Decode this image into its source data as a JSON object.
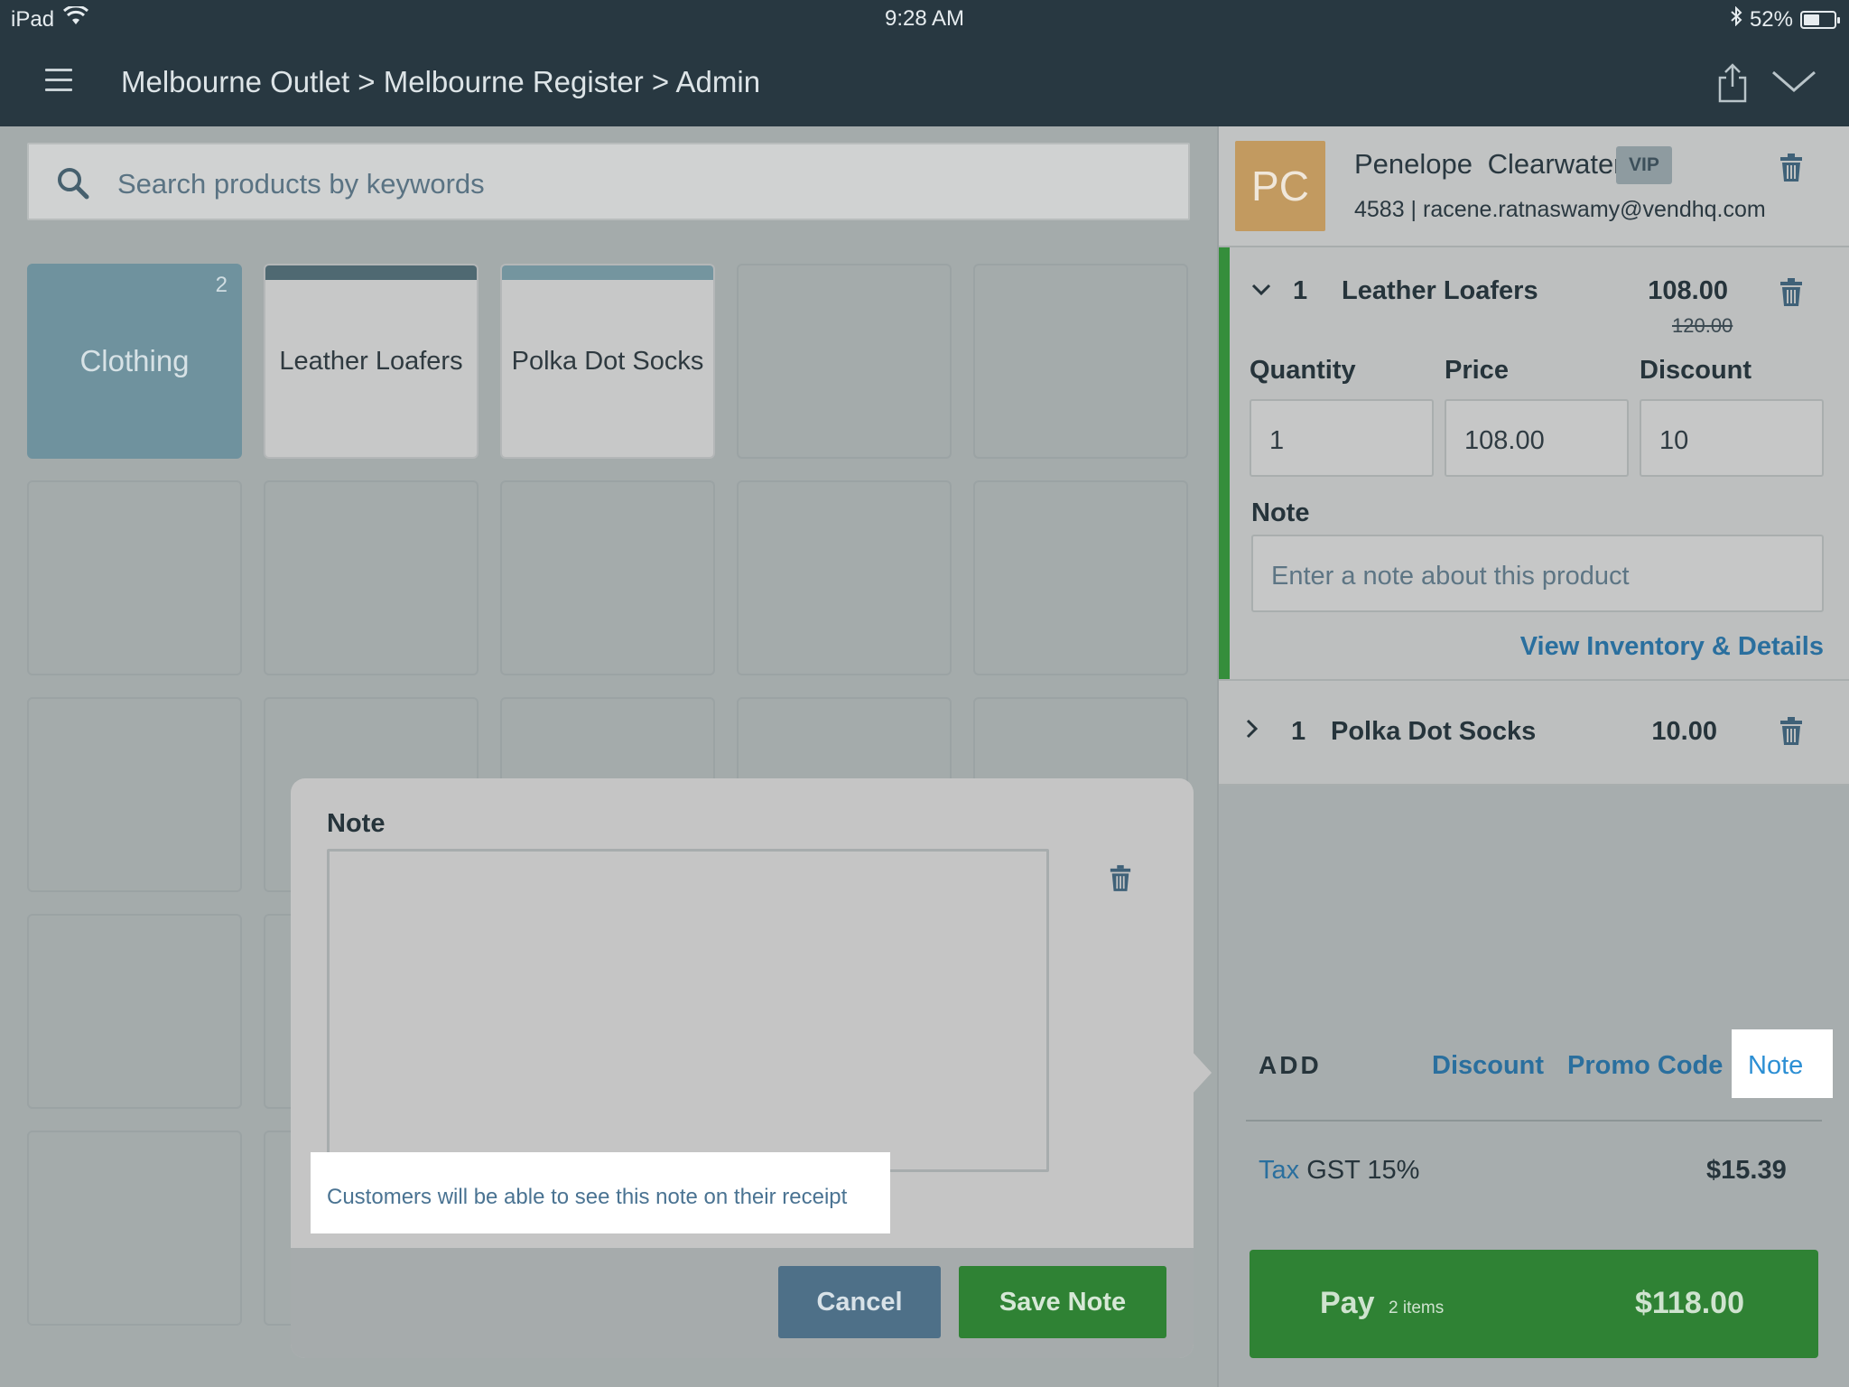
{
  "status_bar": {
    "device": "iPad",
    "time": "9:28 AM",
    "battery": "52%",
    "battery_level": 0.52,
    "icons": [
      "wifi-icon",
      "bluetooth-icon",
      "battery-icon"
    ]
  },
  "header": {
    "breadcrumb": "Melbourne Outlet > Melbourne Register > Admin",
    "icons": [
      "hamburger-menu-icon",
      "share-icon",
      "chevron-down-icon"
    ]
  },
  "search": {
    "placeholder": "Search products by keywords"
  },
  "tiles": [
    {
      "label": "Clothing",
      "count": "2",
      "type": "category"
    },
    {
      "label": "Leather Loafers",
      "type": "product"
    },
    {
      "label": "Polka Dot Socks",
      "type": "product"
    }
  ],
  "customer": {
    "initials": "PC",
    "name": "Penelope  Clearwater",
    "badge": "VIP",
    "details": "4583 | racene.ratnaswamy@vendhq.com"
  },
  "cart": {
    "items": [
      {
        "qty": "1",
        "name": "Leather Loafers",
        "price": "108.00",
        "original_price": "120.00",
        "expanded": true,
        "fields": {
          "quantity_label": "Quantity",
          "quantity_value": "1",
          "price_label": "Price",
          "price_value": "108.00",
          "discount_label": "Discount",
          "discount_value": "10",
          "note_label": "Note",
          "note_placeholder": "Enter a note about this product"
        },
        "details_link": "View Inventory & Details"
      },
      {
        "qty": "1",
        "name": "Polka Dot Socks",
        "price": "10.00",
        "expanded": false
      }
    ],
    "add": {
      "label": "ADD",
      "discount": "Discount",
      "promo": "Promo Code",
      "note": "Note"
    },
    "tax": {
      "link": "Tax",
      "label": "GST 15%",
      "amount": "$15.39"
    },
    "pay": {
      "label": "Pay",
      "items": "2 items",
      "total": "$118.00"
    }
  },
  "note_modal": {
    "title": "Note",
    "hint": "Customers will be able to see this note on their receipt",
    "cancel": "Cancel",
    "save": "Save Note"
  },
  "colors": {
    "header_bg": "#283841",
    "accent_link": "#2a6f9e",
    "pay_green": "#2f8234",
    "category_tile": "#6f929e",
    "avatar": "#c29a60"
  }
}
